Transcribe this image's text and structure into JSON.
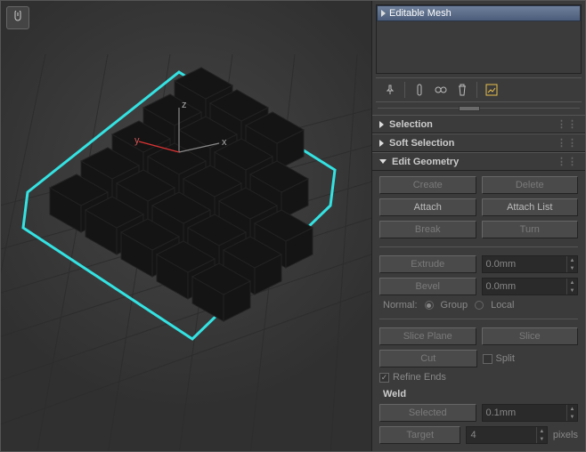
{
  "stack": {
    "item": "Editable Mesh"
  },
  "rollouts": {
    "selection": "Selection",
    "soft": "Soft Selection",
    "editgeom": "Edit Geometry"
  },
  "buttons": {
    "create": "Create",
    "delete": "Delete",
    "attach": "Attach",
    "attachlist": "Attach List",
    "break": "Break",
    "turn": "Turn",
    "extrude": "Extrude",
    "bevel": "Bevel",
    "sliceplane": "Slice Plane",
    "slice": "Slice",
    "cut": "Cut",
    "split": "Split"
  },
  "spin": {
    "extrude": "0.0mm",
    "bevel": "0.0mm",
    "weld_sel": "0.1mm",
    "weld_target": "4"
  },
  "labels": {
    "normal": "Normal:",
    "group": "Group",
    "local": "Local",
    "refine": "Refine Ends",
    "weld": "Weld",
    "selected": "Selected",
    "target": "Target",
    "pixels": "pixels"
  }
}
